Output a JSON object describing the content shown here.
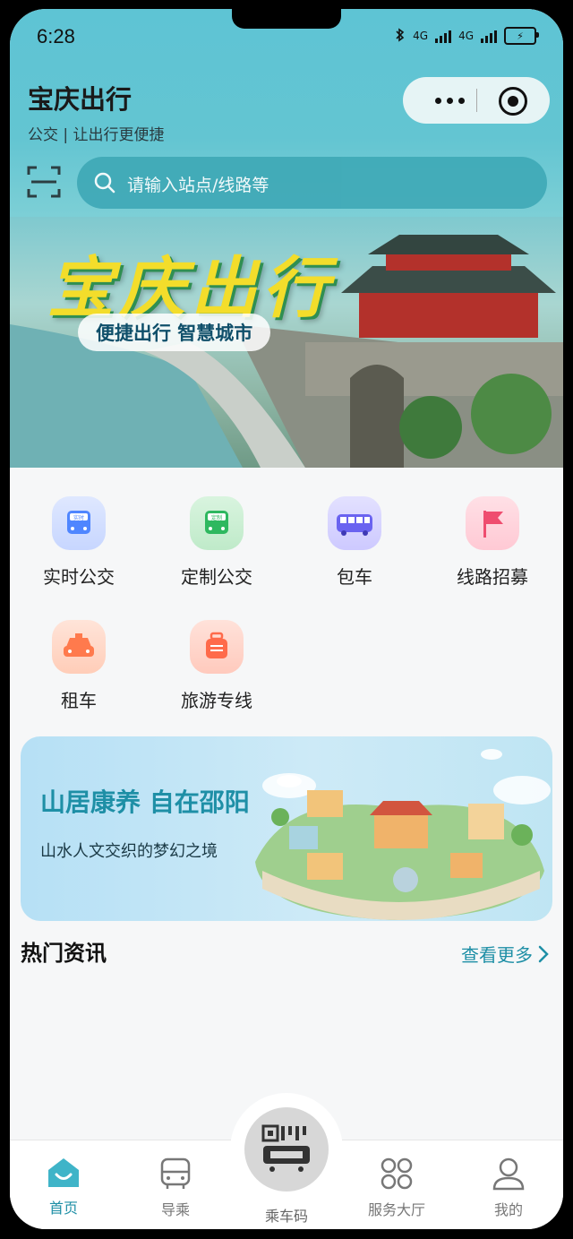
{
  "status": {
    "time": "6:28",
    "net1": "4G",
    "net2": "4G"
  },
  "header": {
    "title": "宝庆出行",
    "subtitle": "公交 | 让出行更便捷"
  },
  "search": {
    "placeholder": "请输入站点/线路等"
  },
  "banner": {
    "title": "宝庆出行",
    "subtitle": "便捷出行 智慧城市"
  },
  "services": [
    {
      "label": "实时公交",
      "icon": "realtime-bus-icon",
      "badge": "实时",
      "color": "#4f86ff"
    },
    {
      "label": "定制公交",
      "icon": "custom-bus-icon",
      "badge": "定制",
      "color": "#2eb85f"
    },
    {
      "label": "包车",
      "icon": "charter-bus-icon",
      "color": "#6a63f0"
    },
    {
      "label": "线路招募",
      "icon": "flag-icon",
      "color": "#ef4d6f"
    },
    {
      "label": "租车",
      "icon": "taxi-icon",
      "color": "#ff7a4d"
    },
    {
      "label": "旅游专线",
      "icon": "luggage-icon",
      "color": "#ff6a4a"
    }
  ],
  "promo": {
    "title": "山居康养 自在邵阳",
    "subtitle": "山水人文交织的梦幻之境"
  },
  "news": {
    "title": "热门资讯",
    "more": "查看更多"
  },
  "tabs": [
    {
      "label": "首页",
      "icon": "home-icon"
    },
    {
      "label": "导乘",
      "icon": "bus-icon"
    },
    {
      "label": "乘车码",
      "icon": "qr-code-icon"
    },
    {
      "label": "服务大厅",
      "icon": "grid-icon"
    },
    {
      "label": "我的",
      "icon": "user-icon"
    }
  ],
  "colors": {
    "accent": "#1e8fa6",
    "header": "#5ec4d4"
  }
}
